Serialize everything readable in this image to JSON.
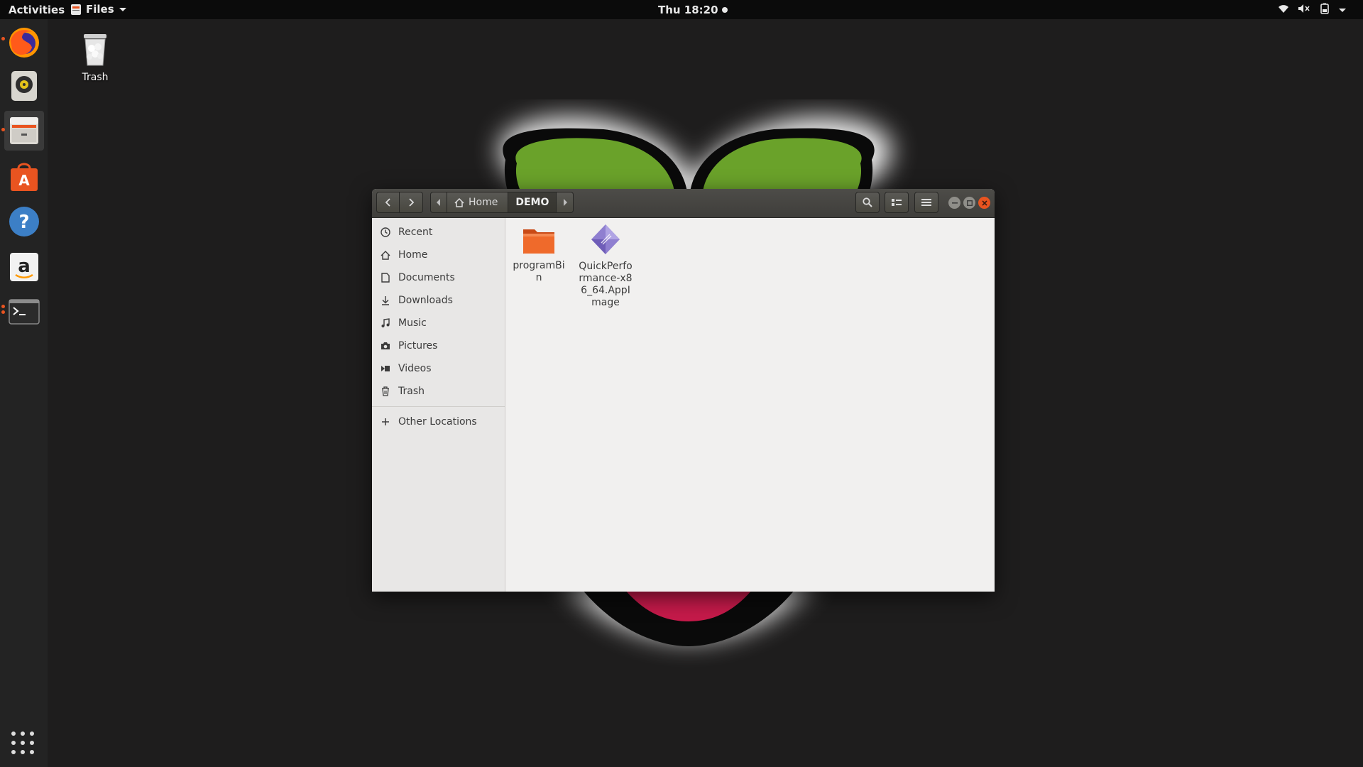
{
  "topbar": {
    "activities": "Activities",
    "app_name": "Files",
    "clock": "Thu 18:20"
  },
  "desktop": {
    "trash_label": "Trash"
  },
  "window": {
    "path": {
      "home": "Home",
      "current": "DEMO"
    },
    "sidebar": {
      "items": [
        {
          "label": "Recent",
          "icon": "clock-icon"
        },
        {
          "label": "Home",
          "icon": "home-icon"
        },
        {
          "label": "Documents",
          "icon": "document-icon"
        },
        {
          "label": "Downloads",
          "icon": "download-icon"
        },
        {
          "label": "Music",
          "icon": "music-icon"
        },
        {
          "label": "Pictures",
          "icon": "camera-icon"
        },
        {
          "label": "Videos",
          "icon": "video-icon"
        },
        {
          "label": "Trash",
          "icon": "trash-icon"
        }
      ],
      "other_locations": "Other Locations"
    },
    "files": [
      {
        "name": "programBin",
        "type": "folder"
      },
      {
        "name": "QuickPerformance-x86_64.AppImage",
        "type": "appimage"
      }
    ]
  },
  "colors": {
    "accent": "#e95420",
    "close_button": "#e95420",
    "wallpaper_leaf": "#6aa22a",
    "wallpaper_berry": "#c51a4a"
  }
}
